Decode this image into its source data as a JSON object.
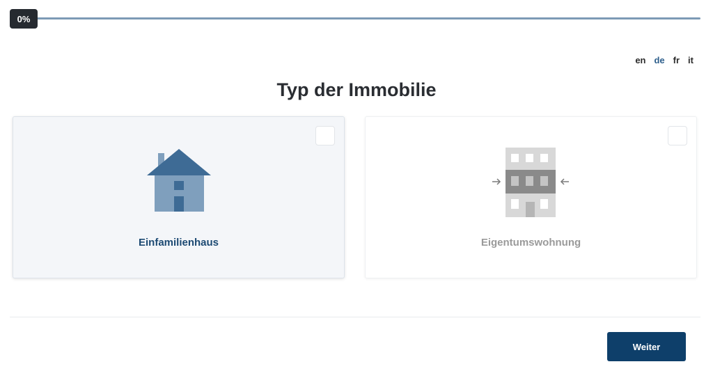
{
  "progress": {
    "label": "0%",
    "value": 0
  },
  "languages": [
    {
      "code": "en",
      "active": false
    },
    {
      "code": "de",
      "active": true
    },
    {
      "code": "fr",
      "active": false
    },
    {
      "code": "it",
      "active": false
    }
  ],
  "title": "Typ der Immobilie",
  "options": [
    {
      "label": "Einfamilienhaus",
      "icon": "house-icon",
      "selected": true
    },
    {
      "label": "Eigentumswohnung",
      "icon": "apartment-icon",
      "selected": false
    }
  ],
  "footer": {
    "next_label": "Weiter"
  },
  "colors": {
    "primary": "#0e3f6a",
    "progress_track": "#7d9ab5",
    "selected_bg": "#f4f6f9"
  }
}
